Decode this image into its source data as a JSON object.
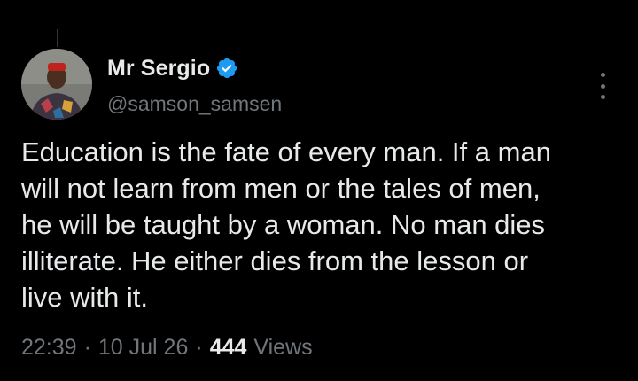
{
  "tweet": {
    "author": {
      "display_name": "Mr Sergio",
      "handle": "@samson_samsen",
      "verified": true
    },
    "text": "Education is the fate of every man. If a man\nwill not learn from men or the tales of men,\nhe will be taught by a woman. No man dies\nilliterate. He either dies from the lesson or\nlive with it.",
    "time": "22:39",
    "date": "10 Jul 26",
    "separator": "·",
    "views_count": "444",
    "views_label": "Views"
  },
  "icons": {
    "verified": "verified-badge-icon",
    "more": "more-vertical-icon"
  },
  "colors": {
    "background": "#000000",
    "primary_text": "#e7e9ea",
    "secondary_text": "#71767b",
    "verified_blue": "#1d9bf0"
  }
}
